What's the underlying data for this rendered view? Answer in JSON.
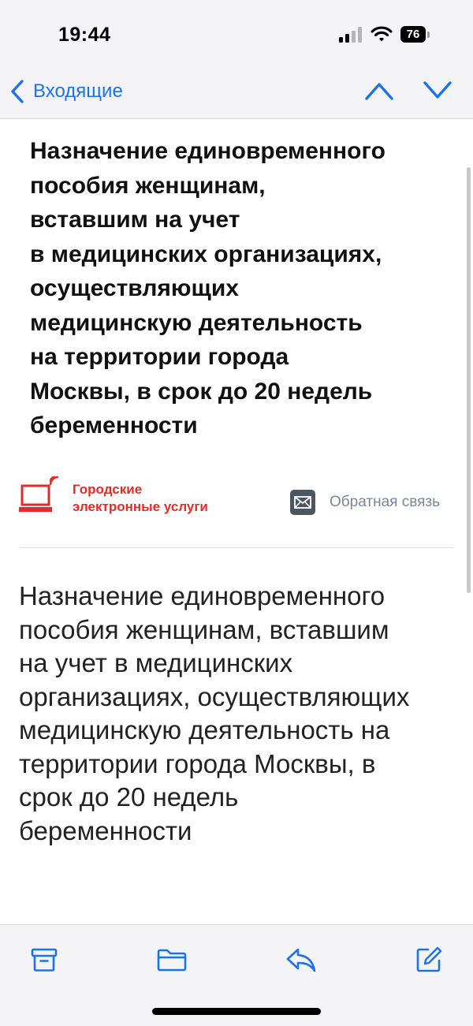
{
  "status_bar": {
    "time": "19:44",
    "battery": "76",
    "icons": [
      "signal-icon",
      "wifi-icon",
      "battery-icon"
    ]
  },
  "nav": {
    "back_label": "Входящие",
    "icons": [
      "chevron-left-icon",
      "chevron-up-icon",
      "chevron-down-icon"
    ]
  },
  "email": {
    "title_lines": [
      "Назначение единовременного",
      "пособия женщинам,",
      "вставшим на учет",
      "в медицинских организациях,",
      "осуществляющих",
      "медицинскую деятельность",
      "на территории города",
      "Москвы, в срок до 20 недель",
      "беременности"
    ],
    "brand": {
      "line1": "Городские",
      "line2": "электронные  услуги",
      "icon": "laptop-signal-icon"
    },
    "feedback": {
      "label": "Обратная связь",
      "icon": "envelope-icon"
    },
    "description_lines": [
      "Назначение единовременного",
      "пособия женщинам, вставшим",
      "на учет в медицинских",
      "организациях, осуществляющих",
      "медицинскую деятельность на",
      "территории города Москвы, в",
      "срок до 20 недель",
      "беременности"
    ]
  },
  "toolbar": {
    "icons": [
      "archive-icon",
      "folder-icon",
      "reply-icon",
      "compose-icon"
    ]
  },
  "colors": {
    "accent": "#1a73e8",
    "brand_red": "#e52a2a",
    "feedback_gray": "#7a8791",
    "chrome_bg": "#f4f4f6"
  }
}
